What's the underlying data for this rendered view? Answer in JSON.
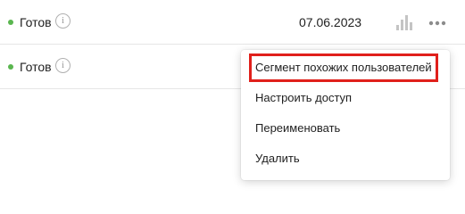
{
  "rows": [
    {
      "status": "Готов",
      "status_color": "#5ab64f",
      "info_icon": "info-icon",
      "info_glyph": "i",
      "date": "07.06.2023",
      "chart_icon": "bar-chart-icon",
      "more_icon": "more-dots-icon"
    },
    {
      "status": "Готов",
      "status_color": "#5ab64f",
      "info_icon": "info-icon",
      "info_glyph": "i"
    }
  ],
  "dropdown": {
    "items": [
      {
        "label": "Сегмент похожих пользователей",
        "highlighted": true
      },
      {
        "label": "Настроить доступ"
      },
      {
        "label": "Переименовать"
      },
      {
        "label": "Удалить"
      }
    ]
  },
  "colors": {
    "status_ready": "#5ab64f",
    "highlight": "#e0201b",
    "icon_gray": "#a8a8a8"
  }
}
